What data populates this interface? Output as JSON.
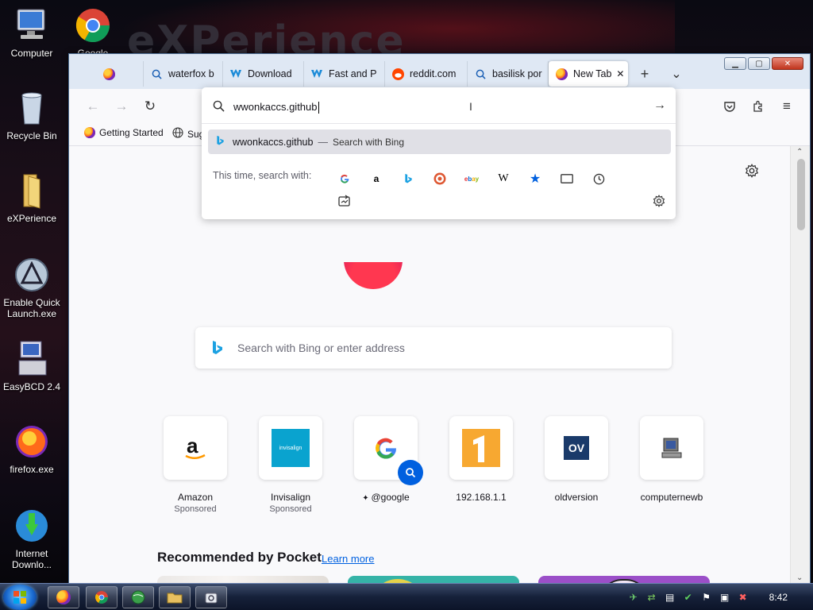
{
  "desktop": {
    "brand_text": "eXPerience",
    "icons": [
      {
        "label": "Computer"
      },
      {
        "label": "Google"
      },
      {
        "label": "Recycle Bin"
      },
      {
        "label": "eXPerience"
      },
      {
        "label": "Enable Quick Launch.exe"
      },
      {
        "label": "EasyBCD 2.4"
      },
      {
        "label": "firefox.exe"
      },
      {
        "label": "Internet Downlo..."
      }
    ]
  },
  "browser": {
    "tabs": [
      {
        "label": "",
        "icon": "firefox-icon"
      },
      {
        "label": "waterfox b",
        "icon": "search-icon"
      },
      {
        "label": "Download",
        "icon": "waterfox-icon"
      },
      {
        "label": "Fast and P",
        "icon": "waterfox-icon"
      },
      {
        "label": "reddit.com",
        "icon": "reddit-icon"
      },
      {
        "label": "basilisk por",
        "icon": "search-icon"
      },
      {
        "label": "New Tab",
        "icon": "firefox-icon",
        "active": true
      }
    ],
    "new_tab_symbol": "+",
    "list_tabs_symbol": "⌄",
    "close_tab_symbol": "✕",
    "bookmarks": [
      {
        "label": "Getting Started",
        "icon": "firefox-icon"
      },
      {
        "label": "Sug",
        "icon": "globe-icon"
      }
    ],
    "urlbar": {
      "value": "wwonkaccs.github",
      "result_text": "wwonkaccs.github",
      "result_sep": "—",
      "result_action": "Search with Bing",
      "engines_label": "This time, search with:",
      "engines": [
        "google",
        "amazon",
        "bing",
        "duckduckgo",
        "ebay",
        "wikipedia",
        "bookmarks",
        "tabs",
        "history",
        "actions"
      ]
    },
    "newtab": {
      "search_placeholder": "Search with Bing or enter address",
      "shortcuts": [
        {
          "label": "Amazon",
          "sub": "Sponsored"
        },
        {
          "label": "Invisalign",
          "sub": "Sponsored",
          "tile_text": "invisalign"
        },
        {
          "label": "@google",
          "sub": ""
        },
        {
          "label": "192.168.1.1",
          "sub": ""
        },
        {
          "label": "oldversion",
          "sub": "",
          "tile_text": "OV"
        },
        {
          "label": "computernewb",
          "sub": ""
        }
      ],
      "pocket_title": "Recommended by Pocket",
      "learn_more": "Learn more"
    }
  },
  "taskbar": {
    "clock": "8:42"
  }
}
